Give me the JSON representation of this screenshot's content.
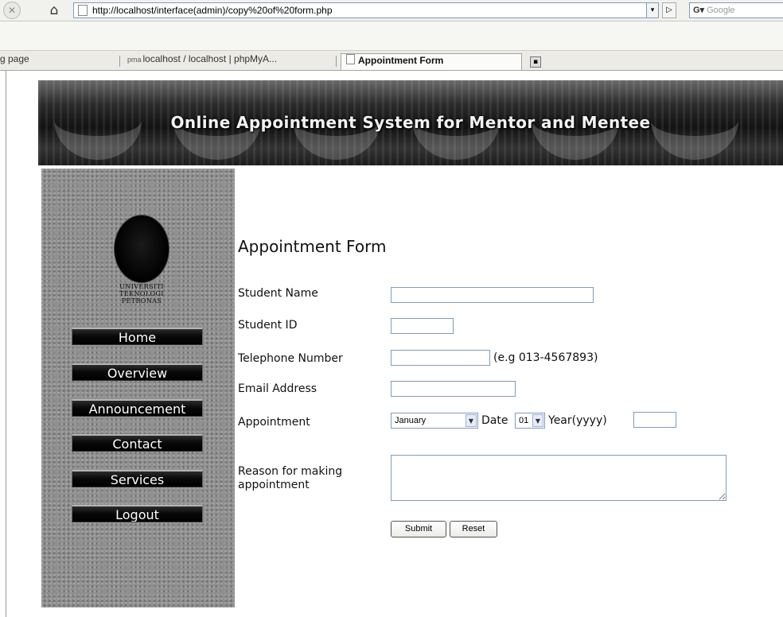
{
  "browser": {
    "url": "http://localhost/interface(admin)/copy%20of%20form.php",
    "search_placeholder": "Google",
    "go_icon": "play-arrow-icon",
    "tabs": [
      {
        "label": "g page"
      },
      {
        "label": "localhost / localhost | phpMyA..."
      },
      {
        "label": "Appointment Form"
      }
    ]
  },
  "page": {
    "banner_title": "Online Appointment System for Mentor and Mentee",
    "logo_lines": [
      "UNIVERSITI",
      "TEKNOLOGI",
      "PETRONAS"
    ],
    "menu": [
      {
        "label": "Home"
      },
      {
        "label": "Overview"
      },
      {
        "label": "Announcement"
      },
      {
        "label": "Contact"
      },
      {
        "label": "Services"
      },
      {
        "label": "Logout"
      }
    ]
  },
  "form": {
    "title": "Appointment Form",
    "labels": {
      "student_name": "Student Name",
      "student_id": "Student ID",
      "telephone": "Telephone Number",
      "email": "Email Address",
      "appointment": "Appointment",
      "reason_line1": "Reason for making",
      "reason_line2": "appointment"
    },
    "telephone_hint": "(e.g 013-4567893)",
    "month_selected": "January",
    "date_label": "Date",
    "date_selected": "01",
    "year_label": "Year(yyyy)",
    "values": {
      "student_name": "",
      "student_id": "",
      "telephone": "",
      "email": "",
      "year": "",
      "reason": ""
    },
    "submit_label": "Submit",
    "reset_label": "Reset"
  },
  "colors": {
    "sidebar": "#8f8f8f",
    "menu_button": "#000000",
    "field_border": "#7f9db9"
  }
}
